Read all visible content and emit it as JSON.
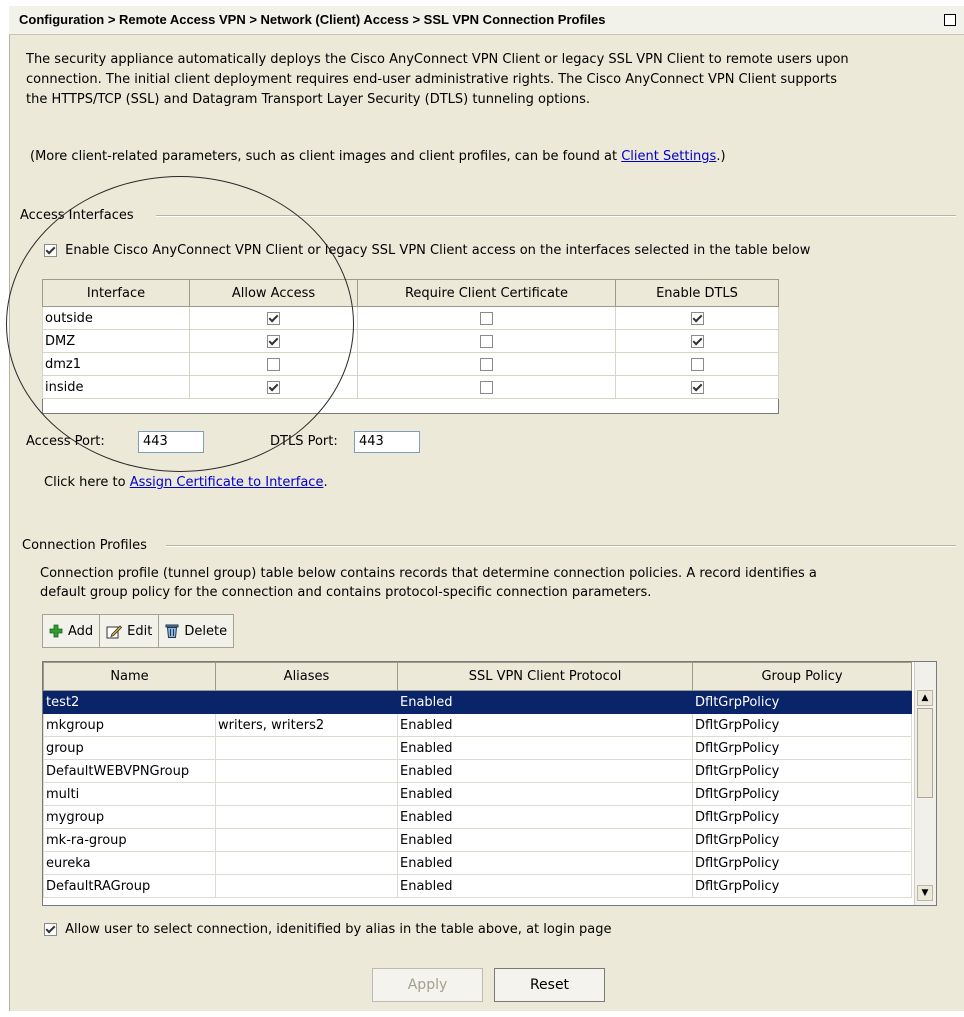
{
  "header": {
    "title": "Configuration > Remote Access VPN > Network (Client) Access > SSL VPN Connection Profiles"
  },
  "intro": {
    "line1": "The security appliance automatically deploys the Cisco AnyConnect VPN Client or legacy SSL VPN Client to remote users upon",
    "line2": "connection. The initial client deployment requires end-user administrative rights. The Cisco AnyConnect VPN Client supports",
    "line3": "the HTTPS/TCP (SSL) and Datagram Transport Layer Security (DTLS) tunneling options.",
    "more_prefix": "(More client-related parameters, such as client images and client profiles, can be found at ",
    "more_link": "Client Settings",
    "more_suffix": ".)"
  },
  "access_interfaces": {
    "group_label": "Access Interfaces",
    "enable_label": "Enable Cisco AnyConnect VPN Client or legacy SSL VPN Client access on the interfaces selected in the table below",
    "enable_checked": true,
    "columns": [
      "Interface",
      "Allow Access",
      "Require Client Certificate",
      "Enable DTLS"
    ],
    "rows": [
      {
        "name": "outside",
        "allow": true,
        "cert": false,
        "dtls": true
      },
      {
        "name": "DMZ",
        "allow": true,
        "cert": false,
        "dtls": true
      },
      {
        "name": "dmz1",
        "allow": false,
        "cert": false,
        "dtls": false
      },
      {
        "name": "inside",
        "allow": true,
        "cert": false,
        "dtls": true
      }
    ],
    "access_port_label": "Access Port:",
    "access_port_value": "443",
    "dtls_port_label": "DTLS Port:",
    "dtls_port_value": "443",
    "assign_prefix": "Click here to ",
    "assign_link": "Assign Certificate to Interface",
    "assign_suffix": "."
  },
  "connection_profiles": {
    "group_label": "Connection Profiles",
    "desc1": "Connection profile (tunnel group) table below contains records that determine connection policies. A record identifies a",
    "desc2": "default group policy for the connection and contains protocol-specific connection parameters.",
    "toolbar": {
      "add": "Add",
      "edit": "Edit",
      "delete": "Delete"
    },
    "columns": [
      "Name",
      "Aliases",
      "SSL VPN Client Protocol",
      "Group Policy"
    ],
    "rows": [
      {
        "name": "test2",
        "aliases": "",
        "protocol": "Enabled",
        "policy": "DfltGrpPolicy",
        "selected": true
      },
      {
        "name": "mkgroup",
        "aliases": "writers, writers2",
        "protocol": "Enabled",
        "policy": "DfltGrpPolicy"
      },
      {
        "name": "group",
        "aliases": "",
        "protocol": "Enabled",
        "policy": "DfltGrpPolicy"
      },
      {
        "name": "DefaultWEBVPNGroup",
        "aliases": "",
        "protocol": "Enabled",
        "policy": "DfltGrpPolicy"
      },
      {
        "name": "multi",
        "aliases": "",
        "protocol": "Enabled",
        "policy": "DfltGrpPolicy"
      },
      {
        "name": "mygroup",
        "aliases": "",
        "protocol": "Enabled",
        "policy": "DfltGrpPolicy"
      },
      {
        "name": "mk-ra-group",
        "aliases": "",
        "protocol": "Enabled",
        "policy": "DfltGrpPolicy"
      },
      {
        "name": "eureka",
        "aliases": "",
        "protocol": "Enabled",
        "policy": "DfltGrpPolicy"
      },
      {
        "name": "DefaultRAGroup",
        "aliases": "",
        "protocol": "Enabled",
        "policy": "DfltGrpPolicy"
      }
    ],
    "allow_select_label": "Allow user to select connection, idenitified by alias in the table above, at login page",
    "allow_select_checked": true
  },
  "footer": {
    "apply": "Apply",
    "reset": "Reset"
  },
  "colors": {
    "panel": "#ece9d8",
    "selection": "#0a246a",
    "link": "#0000cc",
    "add_icon": "#2e9c2e"
  }
}
